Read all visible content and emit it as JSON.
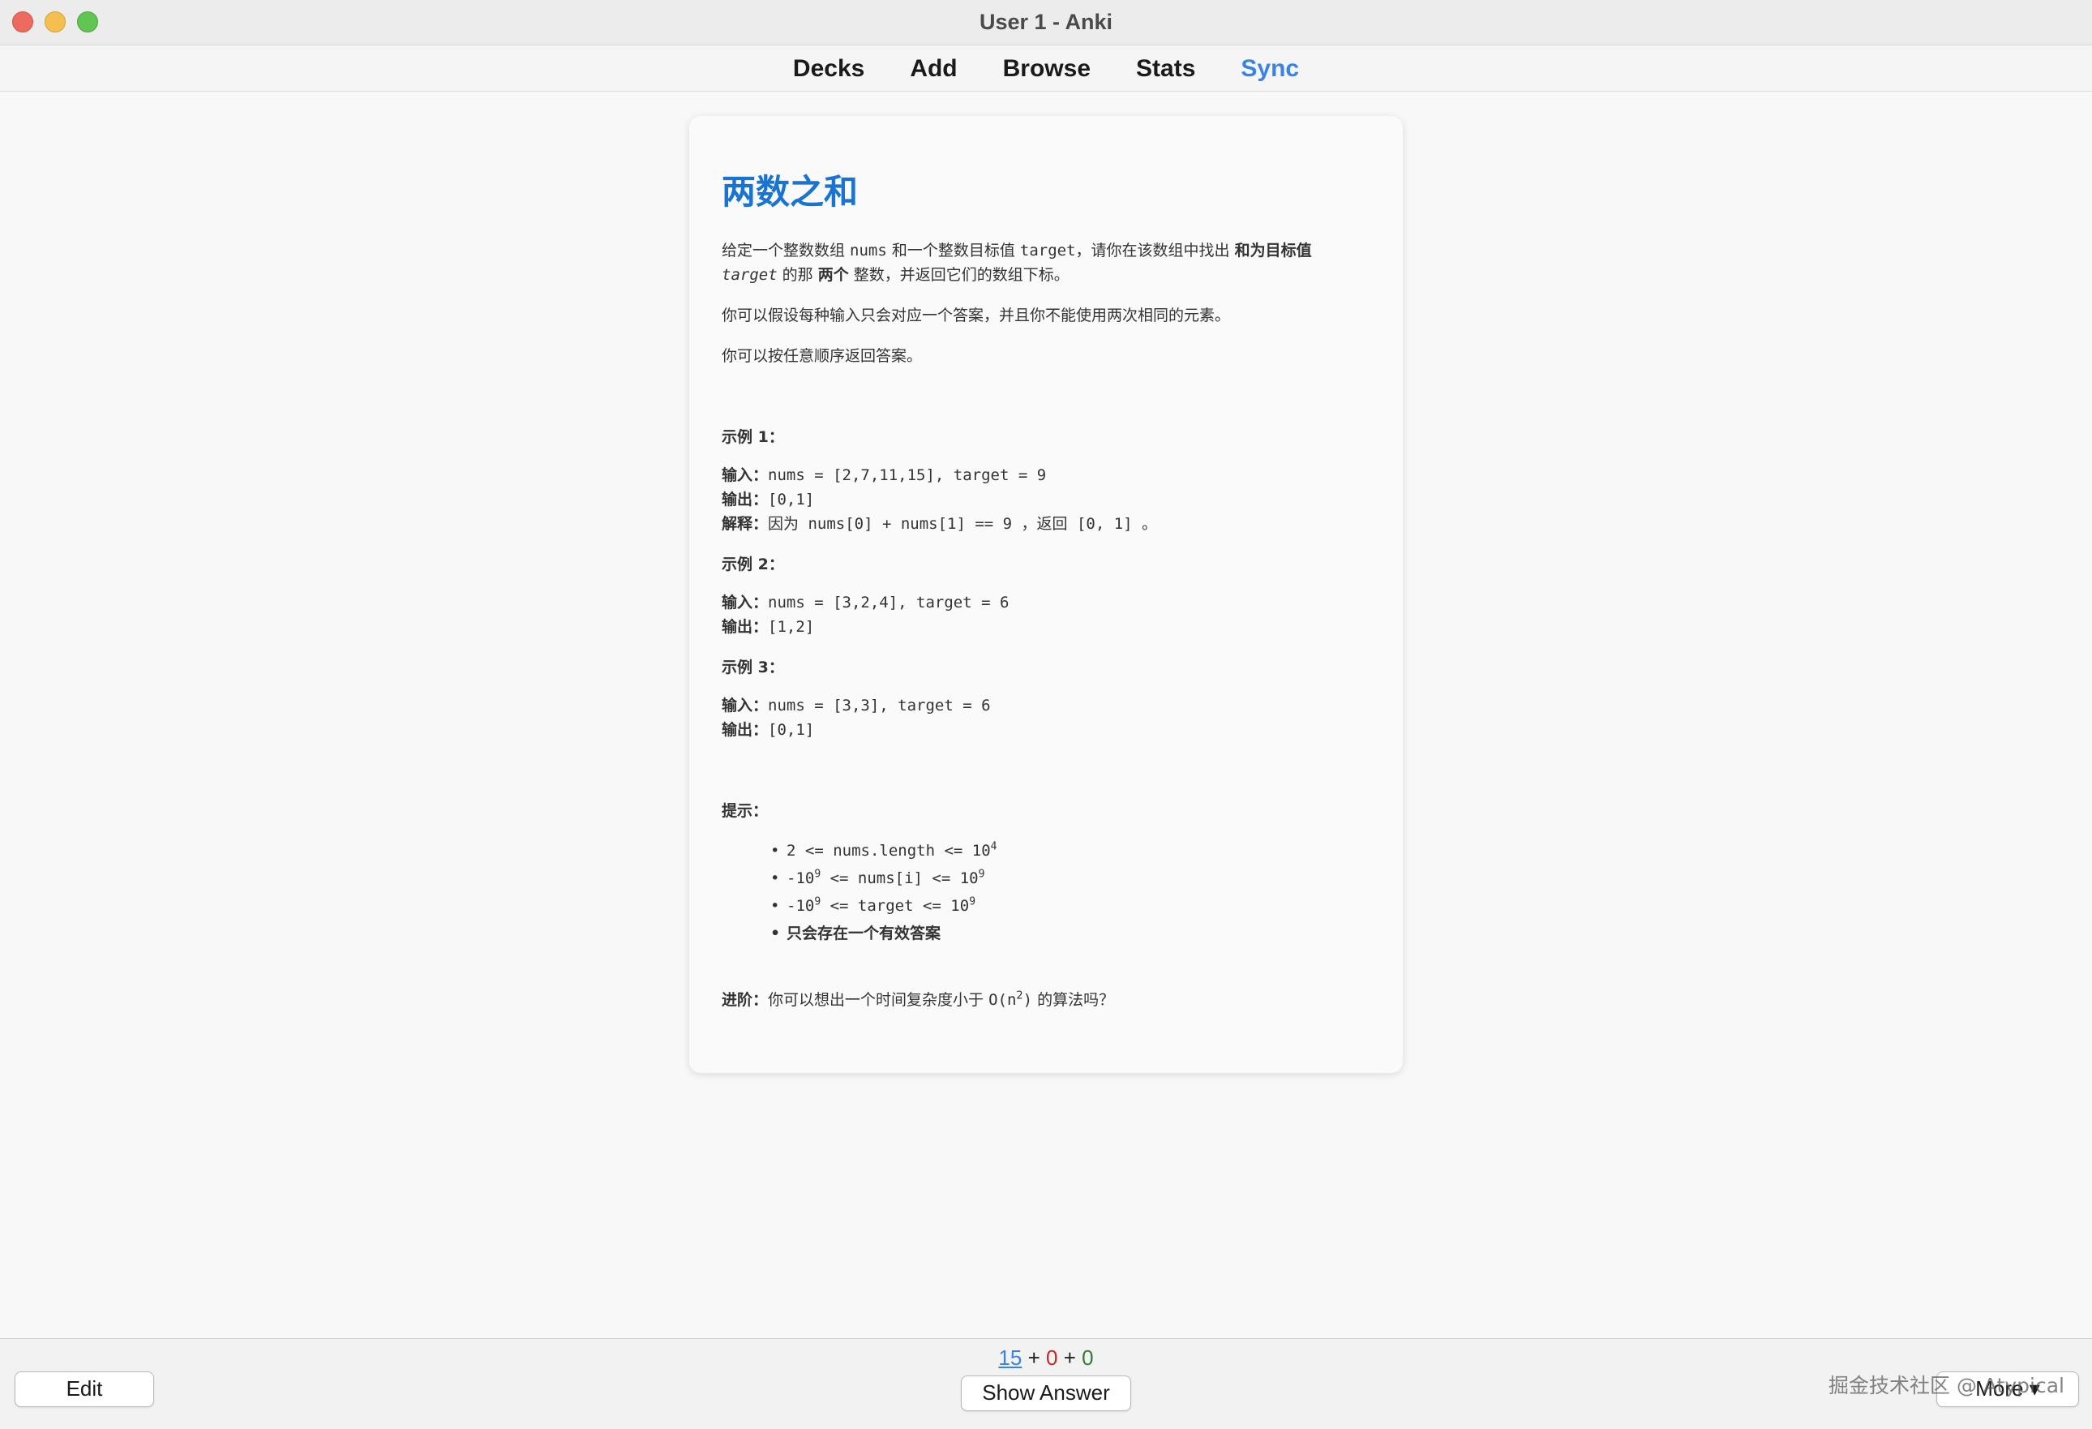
{
  "window": {
    "title": "User 1 - Anki"
  },
  "toolbar": {
    "decks": "Decks",
    "add": "Add",
    "browse": "Browse",
    "stats": "Stats",
    "sync": "Sync"
  },
  "colors": {
    "accent": "#3a82e4",
    "title": "#1874d0",
    "learn": "#c62828",
    "review": "#2e7d32"
  },
  "card": {
    "title": "两数之和",
    "p1_a": "给定一个整数数组 ",
    "p1_nums": "nums",
    "p1_b": " 和一个整数目标值 ",
    "p1_target": "target",
    "p1_c": "，请你在该数组中找出 ",
    "p1_bold1": "和为目标值",
    "p1_target_i": "target",
    "p1_d": " 的那 ",
    "p1_bold2": "两个",
    "p1_e": " 整数，并返回它们的数组下标。",
    "p2": "你可以假设每种输入只会对应一个答案，并且你不能使用两次相同的元素。",
    "p3": "你可以按任意顺序返回答案。",
    "ex1_head": "示例 1：",
    "ex1_in_label": "输入：",
    "ex1_in": "nums = [2,7,11,15], target = 9",
    "ex1_out_label": "输出：",
    "ex1_out": "[0,1]",
    "ex1_exp_label": "解释：",
    "ex1_exp": "因为 nums[0] + nums[1] == 9 ，返回 [0, 1] 。",
    "ex2_head": "示例 2：",
    "ex2_in_label": "输入：",
    "ex2_in": "nums = [3,2,4], target = 6",
    "ex2_out_label": "输出：",
    "ex2_out": "[1,2]",
    "ex3_head": "示例 3：",
    "ex3_in_label": "输入：",
    "ex3_in": "nums = [3,3], target = 6",
    "ex3_out_label": "输出：",
    "ex3_out": "[0,1]",
    "hint_head": "提示：",
    "hint1_a": "2 <= nums.length <= 10",
    "hint1_sup": "4",
    "hint2_a": "-10",
    "hint2_sup1": "9",
    "hint2_b": " <= nums[i] <= 10",
    "hint2_sup2": "9",
    "hint3_a": "-10",
    "hint3_sup1": "9",
    "hint3_b": " <= target <= 10",
    "hint3_sup2": "9",
    "hint4": "只会存在一个有效答案",
    "adv_label": "进阶：",
    "adv_a": "你可以想出一个时间复杂度小于 ",
    "adv_code": "O(n",
    "adv_sup": "2",
    "adv_code2": ")",
    "adv_b": " 的算法吗？"
  },
  "bottom": {
    "edit": "Edit",
    "show_answer": "Show Answer",
    "more": "More ▾",
    "count_new": "15",
    "count_learn": "0",
    "count_review": "0",
    "plus": "+",
    "watermark": "掘金技术社区 @ Atypical"
  }
}
